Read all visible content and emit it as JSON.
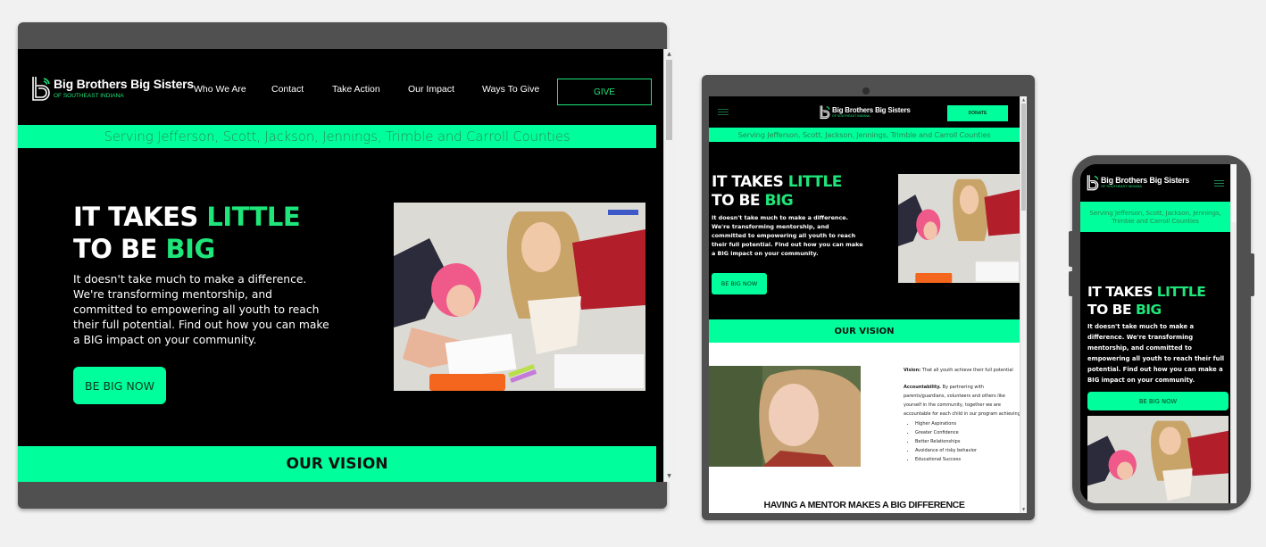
{
  "brand": {
    "name": "Big Brothers Big Sisters",
    "registered": ".",
    "subtitle": "OF SOUTHEAST INDIANA",
    "accent_color": "#00ff9c",
    "text_green": "#1ee67a",
    "logo_icon": "bbbs-logo-icon"
  },
  "desktop": {
    "nav": [
      {
        "label": "Who We Are"
      },
      {
        "label": "Contact"
      },
      {
        "label": "Take Action"
      },
      {
        "label": "Our Impact"
      },
      {
        "label": "Ways To Give"
      }
    ],
    "give_label": "GIVE",
    "service_banner": "Serving Jefferson, Scott, Jackson, Jennings, Trimble and Carroll Counties",
    "hero": {
      "title_part1": "IT TAKES ",
      "title_highlight1": "LITTLE",
      "title_part2": "TO BE ",
      "title_highlight2": "BIG",
      "body": "It doesn't take much to make a difference. We're transforming mentorship, and committed to empowering all youth to reach their full potential. Find out how you can make a BIG impact on your community.",
      "cta_label": "BE BIG NOW",
      "photo_alt": "Mentor and child drawing together on the floor"
    },
    "section_title": "OUR VISION"
  },
  "tablet": {
    "menu_icon": "hamburger-menu-icon",
    "donate_label": "DONATE",
    "service_banner": "Serving Jefferson, Scott, Jackson, Jennings, Trimble and Carroll Counties",
    "hero": {
      "title_part1": "IT TAKES ",
      "title_highlight1": "LITTLE",
      "title_part2": "TO BE ",
      "title_highlight2": "BIG",
      "body": "It doesn't take much to make a difference. We're transforming mentorship, and committed to empowering all youth to reach their full potential. Find out how you can make a BIG impact on your community.",
      "cta_label": "BE BIG NOW"
    },
    "section_title": "OUR VISION",
    "vision": {
      "vision_label": "Vision:",
      "vision_text": " That all youth achieve their full potential",
      "accountability_label": "Accountability.",
      "accountability_text": " By partnering with parents/guardians, volunteers and others like yourself in the community, together we are accountable for each child in our program achieving:",
      "outcomes": [
        "Higher Aspirations",
        "Greater Confidence",
        "Better Relationships",
        "Avoidance of risky behavior",
        "Educational Success"
      ]
    },
    "mentor_heading": "HAVING A MENTOR MAKES A BIG DIFFERENCE"
  },
  "phone": {
    "menu_icon": "hamburger-menu-icon",
    "service_banner": "Serving Jefferson, Scott, Jackson, Jennings, Trimble and Carroll Counties",
    "hero": {
      "title_part1": "IT TAKES ",
      "title_highlight1": "LITTLE",
      "title_part2": "TO BE ",
      "title_highlight2": "BIG",
      "body": "It doesn't take much to make a difference. We're transforming mentorship, and committed to empowering all youth to reach their full potential. Find out how you can make a BIG impact on your community.",
      "cta_label": "BE BIG NOW"
    }
  }
}
